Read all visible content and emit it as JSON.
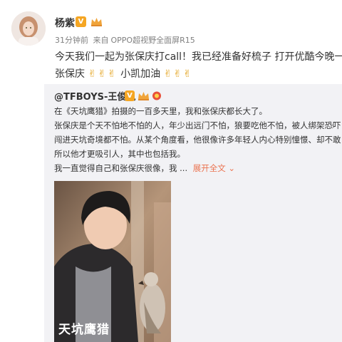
{
  "post": {
    "author": "杨紫",
    "time": "31分钟前",
    "source_prefix": "来自",
    "source": "OPPO超视野全面屏R15",
    "text_line1": "今天我们一起为张保庆打call！我已经准备好梳子 打开优酷今晚一起",
    "text_line2_prefix": "张保庆",
    "text_line2_suffix": "小凯加油"
  },
  "repost": {
    "author": "@TFBOYS-王俊凯",
    "lines": [
      "在《天坑鹰猎》拍摄的一百多天里，我和张保庆都长大了。",
      "张保庆是个天不怕地不怕的人，年少出远门不怕，狼要吃他不怕，被人绑架恐吓",
      "闯进天坑奇境都不怕。从某个角度看，他很像许多年轻人内心特别憧憬、却不敢",
      "所以他才更吸引人，其中也包括我。",
      "我一直觉得自己和张保庆很像，我 ..."
    ],
    "expand_label": "展开全文",
    "photo_title": "天坑鹰猎"
  },
  "icons": {
    "verified": "V",
    "vip": "crown-icon",
    "emoji": "victory-hand-icon",
    "expand": "chevron-down-icon"
  },
  "colors": {
    "verified_badge": "#f5a623",
    "vip_badge": "#f0a43a",
    "link": "#eb7350",
    "repost_bg": "#f2f2f5"
  }
}
